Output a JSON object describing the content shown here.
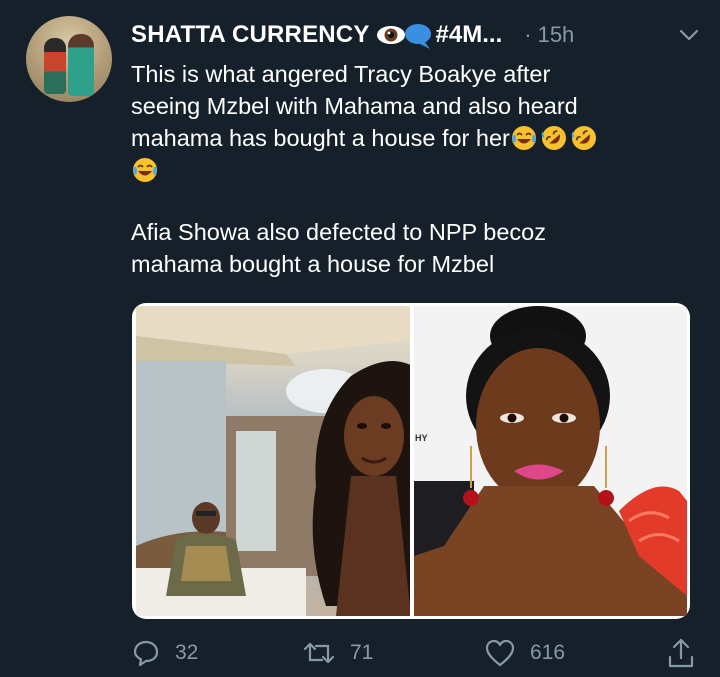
{
  "tweet": {
    "display_name": "SHATTA CURRENCY",
    "name_emoji_1": "eye-emoji",
    "name_emoji_2": "speech-bubble-emoji",
    "hashtag": "#4M...",
    "separator": "·",
    "time": "15h",
    "body_lines": [
      "This is what angered Tracy  Boakye after",
      "seeing Mzbel with Mahama and also heard",
      "mahama has bought a house for her"
    ],
    "body_line_2": [
      "Afia Showa also defected to NPP becoz",
      "mahama bought a house for Mzbel"
    ],
    "emojis_after_line3": [
      "face-with-tears-of-joy",
      "rolling-on-floor-laughing",
      "rolling-on-floor-laughing"
    ],
    "emoji_line4": "face-with-tears-of-joy",
    "watermark": "HY"
  },
  "actions": {
    "reply_count": "32",
    "retweet_count": "71",
    "like_count": "616"
  },
  "icons": {
    "reply": "reply-icon",
    "retweet": "retweet-icon",
    "like": "heart-icon",
    "share": "share-icon",
    "more": "chevron-down-icon"
  },
  "colors": {
    "background": "#15202b",
    "secondary_text": "#8899a6",
    "primary_text": "#ffffff"
  }
}
